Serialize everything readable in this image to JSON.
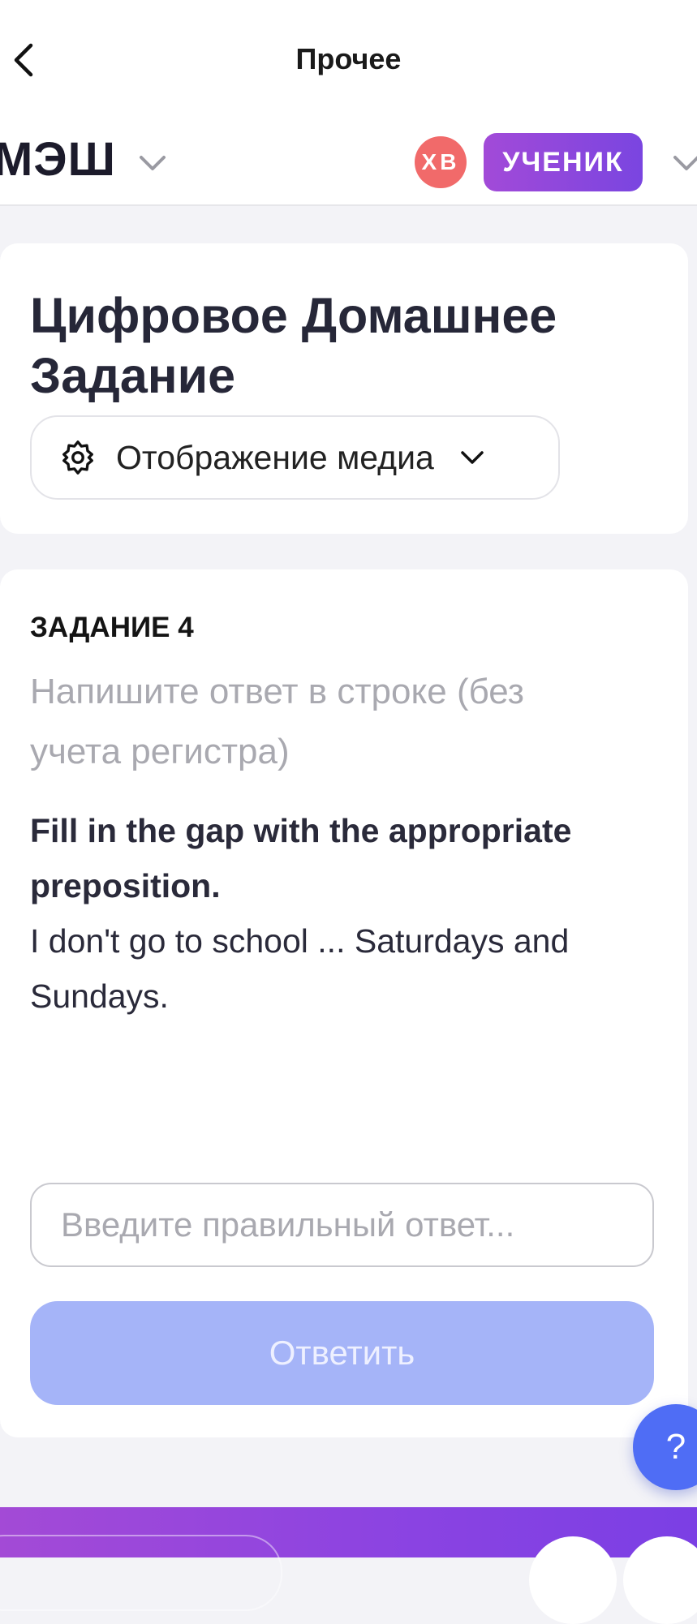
{
  "nav": {
    "title": "Прочее"
  },
  "header": {
    "logo": "МЭШ",
    "avatar_initials": "ХВ",
    "role": "УЧЕНИК"
  },
  "page": {
    "title": "Цифровое Домашнее Задание",
    "media_select_label": "Отображение медиа"
  },
  "task": {
    "number_label": "ЗАДАНИЕ 4",
    "hint": "Напишите ответ в строке (без учета регистра)",
    "instruction": "Fill in the gap with the appropriate preposition.",
    "sentence": "I don't go to school ... Saturdays and Sundays.",
    "input_value": "",
    "input_placeholder": "Введите правильный ответ...",
    "submit_label": "Ответить"
  },
  "help": {
    "label": "?"
  },
  "icons": {
    "back": "chevron-left-icon",
    "logo_dropdown": "chevron-down-icon",
    "role_dropdown": "chevron-down-icon",
    "media": "gear-icon",
    "media_dropdown": "chevron-down-icon"
  },
  "colors": {
    "accent_purple": "#8a43e2",
    "avatar_red": "#f16a6a",
    "submit_disabled": "#a5b4f8",
    "help_blue": "#4f6df5"
  }
}
